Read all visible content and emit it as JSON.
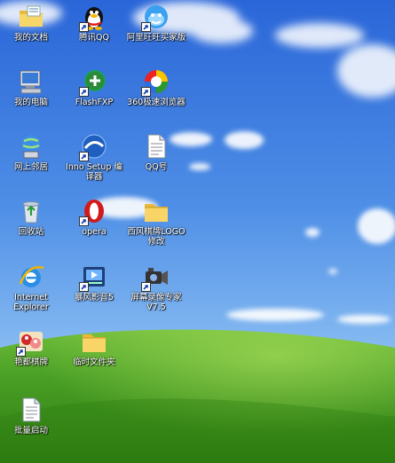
{
  "desktop": {
    "icons": [
      {
        "id": "my-documents",
        "label": "我的文档",
        "icon": "folder-documents-icon",
        "shortcut": false
      },
      {
        "id": "tencent-qq",
        "label": "腾讯QQ",
        "icon": "qq-penguin-icon",
        "shortcut": true
      },
      {
        "id": "aliwangwang",
        "label": "阿里旺旺买家版",
        "icon": "aliwangwang-icon",
        "shortcut": true
      },
      {
        "id": "my-computer",
        "label": "我的电脑",
        "icon": "computer-icon",
        "shortcut": false
      },
      {
        "id": "flashfxp",
        "label": "FlashFXP",
        "icon": "flashfxp-icon",
        "shortcut": true
      },
      {
        "id": "browser-360",
        "label": "360极速浏览器",
        "icon": "360-browser-icon",
        "shortcut": true
      },
      {
        "id": "network-places",
        "label": "网上邻居",
        "icon": "network-places-icon",
        "shortcut": false
      },
      {
        "id": "inno-setup",
        "label": "Inno Setup 编译器",
        "icon": "inno-setup-icon",
        "shortcut": true
      },
      {
        "id": "qq-number",
        "label": "QQ号",
        "icon": "text-document-icon",
        "shortcut": false
      },
      {
        "id": "recycle-bin",
        "label": "回收站",
        "icon": "recycle-bin-icon",
        "shortcut": false
      },
      {
        "id": "opera",
        "label": "opera",
        "icon": "opera-icon",
        "shortcut": true
      },
      {
        "id": "xiyou-logo",
        "label": "西风棋牌LOGO修改",
        "icon": "folder-icon",
        "shortcut": false
      },
      {
        "id": "internet-explorer",
        "label": "Internet Explorer",
        "icon": "internet-explorer-icon",
        "shortcut": false
      },
      {
        "id": "baofeng",
        "label": "暴风影音5",
        "icon": "video-player-icon",
        "shortcut": true
      },
      {
        "id": "screen-recorder",
        "label": "屏幕录像专家V7.5",
        "icon": "video-camera-icon",
        "shortcut": true
      },
      {
        "id": "chess-games",
        "label": "艳都棋牌",
        "icon": "chess-game-icon",
        "shortcut": true
      },
      {
        "id": "temp-folder",
        "label": "临时文件夹",
        "icon": "folder-icon",
        "shortcut": false
      },
      {
        "id": "batch-start",
        "label": "批量启动",
        "icon": "text-document-icon",
        "shortcut": false
      }
    ]
  }
}
